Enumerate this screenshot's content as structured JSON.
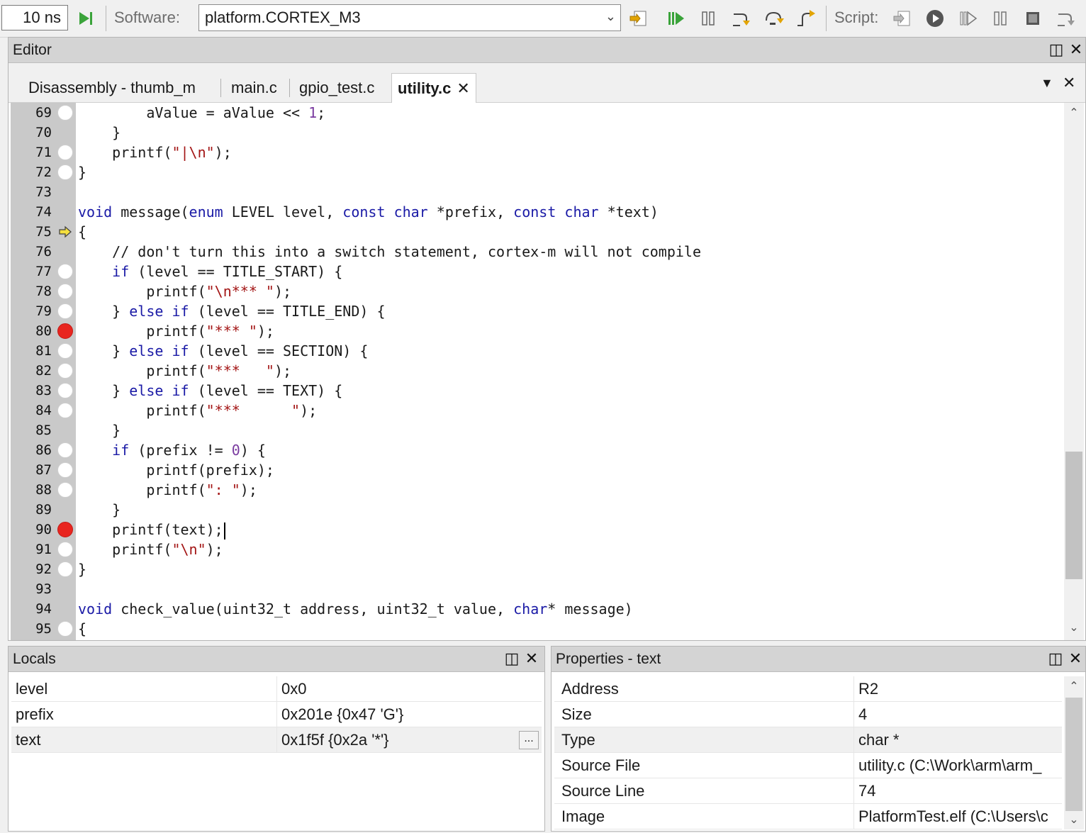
{
  "toolbar": {
    "time_value": "10 ns",
    "software_label": "Software:",
    "software_value": "platform.CORTEX_M3",
    "script_label": "Script:"
  },
  "colors": {
    "keyword": "#1a1aa6",
    "string": "#a31515",
    "number": "#7a3ba0",
    "breakpoint": "#e8251f",
    "gutter": "#c9c9c9",
    "panel_header": "#d4d4d4"
  },
  "editor": {
    "title": "Editor",
    "tabs": [
      {
        "label": "Disassembly - thumb_m"
      },
      {
        "label": "main.c"
      },
      {
        "label": "gpio_test.c"
      },
      {
        "label": "utility.c"
      }
    ],
    "active_tab": "utility.c",
    "lines": [
      {
        "num": "69",
        "marker": "empty",
        "tokens": [
          [
            "t",
            "        aValue = aValue << "
          ],
          [
            "n",
            "1"
          ],
          [
            "t",
            ";"
          ]
        ]
      },
      {
        "num": "70",
        "marker": "none",
        "tokens": [
          [
            "t",
            "    }"
          ]
        ]
      },
      {
        "num": "71",
        "marker": "empty",
        "tokens": [
          [
            "t",
            "    printf("
          ],
          [
            "s",
            "\"|\\n\""
          ],
          [
            "t",
            ");"
          ]
        ]
      },
      {
        "num": "72",
        "marker": "empty",
        "tokens": [
          [
            "t",
            "}"
          ]
        ]
      },
      {
        "num": "73",
        "marker": "none",
        "tokens": []
      },
      {
        "num": "74",
        "marker": "none",
        "tokens": [
          [
            "k",
            "void"
          ],
          [
            "t",
            " message("
          ],
          [
            "k",
            "enum"
          ],
          [
            "t",
            " LEVEL level, "
          ],
          [
            "k",
            "const"
          ],
          [
            "t",
            " "
          ],
          [
            "k",
            "char"
          ],
          [
            "t",
            " *prefix, "
          ],
          [
            "k",
            "const"
          ],
          [
            "t",
            " "
          ],
          [
            "k",
            "char"
          ],
          [
            "t",
            " *text)"
          ]
        ]
      },
      {
        "num": "75",
        "marker": "arrow",
        "tokens": [
          [
            "t",
            "{"
          ]
        ]
      },
      {
        "num": "76",
        "marker": "none",
        "tokens": [
          [
            "t",
            "    // don't turn this into a switch statement, cortex-m will not compile"
          ]
        ]
      },
      {
        "num": "77",
        "marker": "empty",
        "tokens": [
          [
            "t",
            "    "
          ],
          [
            "k",
            "if"
          ],
          [
            "t",
            " (level == TITLE_START) {"
          ]
        ]
      },
      {
        "num": "78",
        "marker": "empty",
        "tokens": [
          [
            "t",
            "        printf("
          ],
          [
            "s",
            "\"\\n*** \""
          ],
          [
            "t",
            ");"
          ]
        ]
      },
      {
        "num": "79",
        "marker": "empty",
        "tokens": [
          [
            "t",
            "    } "
          ],
          [
            "k",
            "else if"
          ],
          [
            "t",
            " (level == TITLE_END) {"
          ]
        ]
      },
      {
        "num": "80",
        "marker": "bp",
        "tokens": [
          [
            "t",
            "        printf("
          ],
          [
            "s",
            "\"*** \""
          ],
          [
            "t",
            ");"
          ]
        ]
      },
      {
        "num": "81",
        "marker": "empty",
        "tokens": [
          [
            "t",
            "    } "
          ],
          [
            "k",
            "else if"
          ],
          [
            "t",
            " (level == SECTION) {"
          ]
        ]
      },
      {
        "num": "82",
        "marker": "empty",
        "tokens": [
          [
            "t",
            "        printf("
          ],
          [
            "s",
            "\"***   \""
          ],
          [
            "t",
            ");"
          ]
        ]
      },
      {
        "num": "83",
        "marker": "empty",
        "tokens": [
          [
            "t",
            "    } "
          ],
          [
            "k",
            "else if"
          ],
          [
            "t",
            " (level == TEXT) {"
          ]
        ]
      },
      {
        "num": "84",
        "marker": "empty",
        "tokens": [
          [
            "t",
            "        printf("
          ],
          [
            "s",
            "\"***      \""
          ],
          [
            "t",
            ");"
          ]
        ]
      },
      {
        "num": "85",
        "marker": "none",
        "tokens": [
          [
            "t",
            "    }"
          ]
        ]
      },
      {
        "num": "86",
        "marker": "empty",
        "tokens": [
          [
            "t",
            "    "
          ],
          [
            "k",
            "if"
          ],
          [
            "t",
            " (prefix != "
          ],
          [
            "n",
            "0"
          ],
          [
            "t",
            ") {"
          ]
        ]
      },
      {
        "num": "87",
        "marker": "empty",
        "tokens": [
          [
            "t",
            "        printf(prefix);"
          ]
        ]
      },
      {
        "num": "88",
        "marker": "empty",
        "tokens": [
          [
            "t",
            "        printf("
          ],
          [
            "s",
            "\": \""
          ],
          [
            "t",
            ");"
          ]
        ]
      },
      {
        "num": "89",
        "marker": "none",
        "tokens": [
          [
            "t",
            "    }"
          ]
        ]
      },
      {
        "num": "90",
        "marker": "bp",
        "caret": true,
        "tokens": [
          [
            "t",
            "    printf(text);"
          ]
        ]
      },
      {
        "num": "91",
        "marker": "empty",
        "tokens": [
          [
            "t",
            "    printf("
          ],
          [
            "s",
            "\"\\n\""
          ],
          [
            "t",
            ");"
          ]
        ]
      },
      {
        "num": "92",
        "marker": "empty",
        "tokens": [
          [
            "t",
            "}"
          ]
        ]
      },
      {
        "num": "93",
        "marker": "none",
        "tokens": []
      },
      {
        "num": "94",
        "marker": "none",
        "tokens": [
          [
            "k",
            "void"
          ],
          [
            "t",
            " check_value(uint32_t address, uint32_t value, "
          ],
          [
            "k",
            "char"
          ],
          [
            "t",
            "* message)"
          ]
        ]
      },
      {
        "num": "95",
        "marker": "empty",
        "tokens": [
          [
            "t",
            "{"
          ]
        ]
      }
    ]
  },
  "locals": {
    "title": "Locals",
    "rows": [
      {
        "name": "level",
        "value": "0x0"
      },
      {
        "name": "prefix",
        "value": "0x201e {0x47 'G'}"
      },
      {
        "name": "text",
        "value": "0x1f5f {0x2a '*'}",
        "button": "..."
      }
    ]
  },
  "properties": {
    "title": "Properties - text",
    "rows": [
      {
        "name": "Address",
        "value": "R2"
      },
      {
        "name": "Size",
        "value": "4"
      },
      {
        "name": "Type",
        "value": "char *"
      },
      {
        "name": "Source File",
        "value": "utility.c (C:\\Work\\arm\\arm_"
      },
      {
        "name": "Source Line",
        "value": "74"
      },
      {
        "name": "Image",
        "value": "PlatformTest.elf (C:\\Users\\c"
      }
    ]
  }
}
